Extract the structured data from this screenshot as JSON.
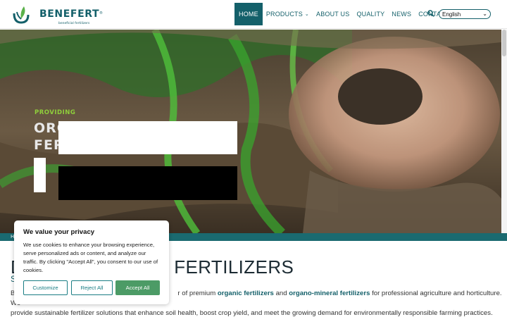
{
  "header": {
    "logo_word": "BENEFERT",
    "logo_reg": "®",
    "logo_tagline": "beneficial fertilizers",
    "nav": [
      {
        "label": "HOME",
        "active": true
      },
      {
        "label": "PRODUCTS",
        "has_dropdown": true
      },
      {
        "label": "ABOUT US"
      },
      {
        "label": "QUALITY"
      },
      {
        "label": "NEWS"
      },
      {
        "label": "CONTACT"
      }
    ],
    "search_icon": "search-icon",
    "language": "English",
    "brand_color": "#14606a"
  },
  "hero": {
    "kicker": "PROVIDING",
    "title_line1": "ORG",
    "title_line2": "FER"
  },
  "breadcrumb": {
    "text": "H"
  },
  "content": {
    "title": "D                            FERTILIZERS",
    "title_visible_left": "D",
    "title_visible_right": "FERTILIZERS",
    "subtitle": "S",
    "intro_start": "B",
    "intro_mid": "r of premium ",
    "organic": "organic fertilizers",
    "and": " and ",
    "organo": "organo-mineral fertilizers",
    "intro_end": " for professional agriculture and horticulture. We",
    "intro_line2": "provide sustainable fertilizer solutions that enhance soil health, boost crop yield, and meet the growing demand for environmentally responsible farming practices."
  },
  "cookie": {
    "title": "We value your privacy",
    "text": "We use cookies to enhance your browsing experience, serve personalized ads or content, and analyze our traffic. By clicking \"Accept All\", you consent to our use of cookies.",
    "customize": "Customize",
    "reject": "Reject All",
    "accept": "Accept All"
  }
}
